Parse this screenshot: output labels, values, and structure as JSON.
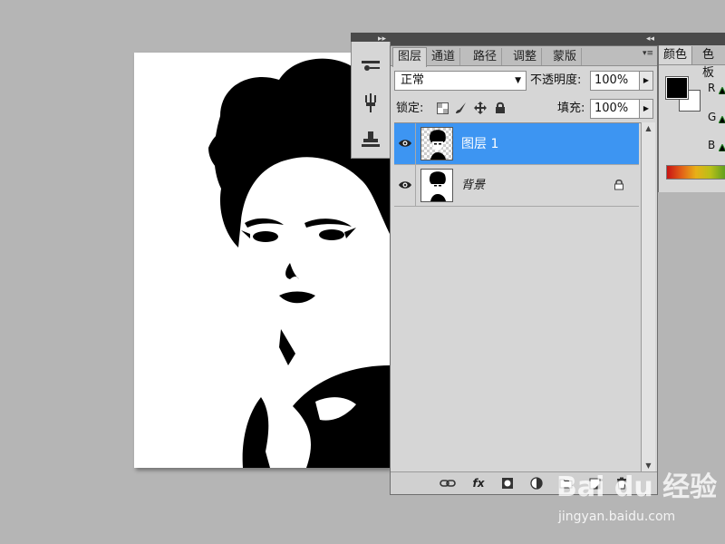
{
  "panel_arrows": {
    "left": "▸▸",
    "right": "◂◂"
  },
  "layers_panel": {
    "tabs": [
      {
        "label": "图层",
        "active": true
      },
      {
        "label": "通道",
        "active": false
      },
      {
        "label": "路径",
        "active": false
      },
      {
        "label": "调整",
        "active": false
      },
      {
        "label": "蒙版",
        "active": false
      }
    ],
    "menu_glyph": "▾≡",
    "blend_mode": "正常",
    "opacity_label": "不透明度:",
    "opacity_value": "100%",
    "lock_label": "锁定:",
    "fill_label": "填充:",
    "fill_value": "100%",
    "layers": [
      {
        "name": "图层 1",
        "selected": true,
        "locked": false
      },
      {
        "name": "背景",
        "selected": false,
        "locked": true
      }
    ]
  },
  "color_panel": {
    "tabs": [
      {
        "label": "颜色",
        "active": true
      },
      {
        "label": "色板",
        "active": false
      }
    ],
    "channels": [
      "R",
      "G",
      "B"
    ],
    "foreground": "#000000",
    "background": "#ffffff"
  },
  "watermark": {
    "brand": "Bai du 经验",
    "url": "jingyan.baidu.com"
  },
  "colors": {
    "selection": "#3d95f2",
    "panel": "#d6d6d6",
    "workspace": "#b5b5b5"
  }
}
